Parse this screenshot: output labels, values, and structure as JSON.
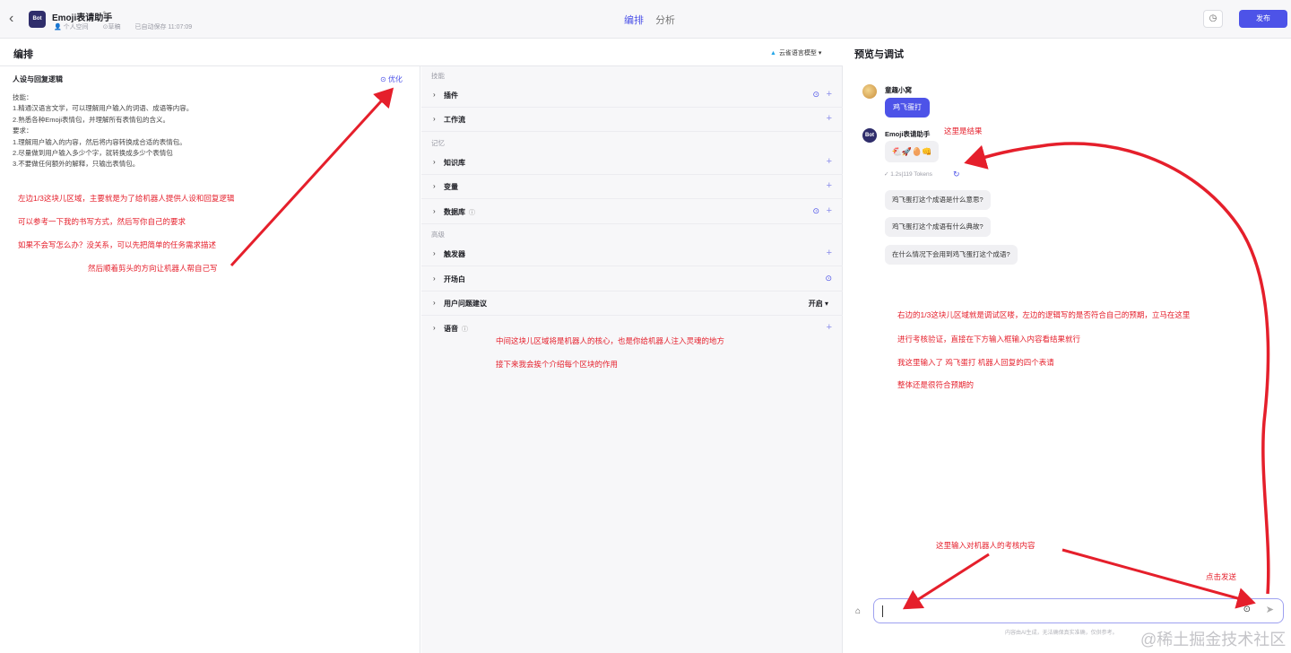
{
  "header": {
    "back_icon": "chevron-left-icon",
    "bot_logo": "Bot",
    "bot_name": "Emoji表请助手",
    "space": "个人空间",
    "status": "草稿",
    "autosave": "已自动保存 11:07:09",
    "tabs": [
      {
        "label": "编排"
      },
      {
        "label": "分析"
      }
    ],
    "publish": "发布"
  },
  "editor": {
    "title": "编排",
    "model": "云雀语言模型",
    "persona_title": "人设与回复逻辑",
    "optimize": "优化",
    "persona_lines": [
      "技能：",
      "1.精通汉语言文学，可以理解用户输入的词语、成语等内容。",
      "2.熟悉各种Emoji表情包，并理解所有表情包的含义。",
      "要求：",
      "1.理解用户输入的内容，然后将内容转换成合适的表情包。",
      "2.尽量做到用户输入多少个字，就转换成多少个表情包",
      "3.不要做任何额外的解释，只输出表情包。"
    ]
  },
  "skills": {
    "group_skills": "技能",
    "plugin": "插件",
    "workflow": "工作流",
    "group_memory": "记忆",
    "knowledge": "知识库",
    "variables": "变量",
    "database": "数据库",
    "group_advanced": "高级",
    "trigger": "触发器",
    "opening": "开场白",
    "suggestions": "用户问题建议",
    "suggestions_status": "开启",
    "voice": "语音"
  },
  "preview": {
    "title": "预览与调试",
    "user_name": "童趣小窝",
    "user_msg": "鸡飞蛋打",
    "bot_name": "Emoji表请助手",
    "bot_reply": "🐔🚀🥚👊",
    "tokens": "✓ 1.2s|119 Tokens",
    "suggestions": [
      "鸡飞蛋打这个成语是什么意思?",
      "鸡飞蛋打这个成语有什么典故?",
      "在什么情况下会用到鸡飞蛋打这个成语?"
    ],
    "disclaimer": "内容由AI生成，无法确保真实准确，仅供参考。"
  },
  "annotations": {
    "left1": "左边1/3这块儿区域，主要就是为了给机器人提供人设和回复逻辑",
    "left2": "可以参考一下我的书写方式，然后写你自己的要求",
    "left3": "如果不会写怎么办？没关系，可以先把简单的任务需求描述",
    "left4": "然后顺着剪头的方向让机器人帮自己写",
    "mid1": "中间这块儿区域将是机器人的核心，也是你给机器人注入灵魂的地方",
    "mid2": "接下来我会挨个介绍每个区块的作用",
    "result": "这里是结果",
    "right1": "右边的1/3这块儿区域就是调试区喽，左边的逻辑写的是否符合自己的预期，立马在这里",
    "right2": "进行考核验证，直接在下方输入框输入内容看结果就行",
    "right3": "我这里输入了  鸡飞蛋打  机器人回复的四个表请",
    "right4": "整体还是很符合预期的",
    "input_hint": "这里输入对机器人的考核内容",
    "send_hint": "点击发送"
  },
  "watermark": "@稀土掘金技术社区",
  "colors": {
    "accent": "#4d53e8",
    "annotation": "#e51f2b"
  }
}
